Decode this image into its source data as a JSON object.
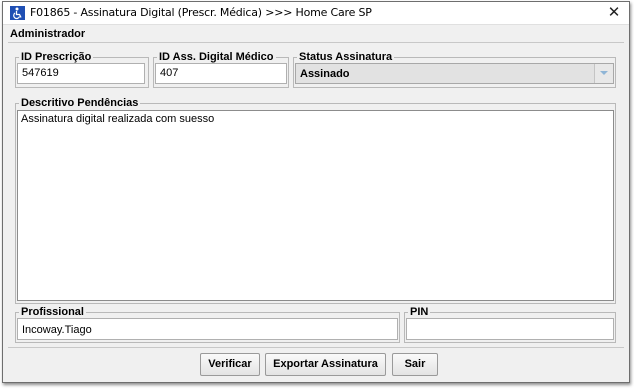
{
  "window": {
    "title": "F01865 - Assinatura Digital (Prescr. Médica) >>> Home Care SP",
    "close_symbol": "✕"
  },
  "menubar": {
    "items": [
      "Administrador"
    ]
  },
  "form": {
    "id_prescricao": {
      "label": "ID Prescrição",
      "value": "547619"
    },
    "id_ass_digital": {
      "label": "ID Ass. Digital Médico",
      "value": "407"
    },
    "status_assinatura": {
      "label": "Status Assinatura",
      "selected": "Assinado"
    },
    "descritivo": {
      "label": "Descritivo Pendências",
      "value": "Assinatura digital realizada com suesso"
    },
    "profissional": {
      "label": "Profissional",
      "value": "Incoway.Tiago"
    },
    "pin": {
      "label": "PIN",
      "value": ""
    }
  },
  "buttons": {
    "verificar": "Verificar",
    "exportar": "Exportar Assinatura",
    "sair": "Sair"
  },
  "icons": {
    "app": "wheelchair-icon",
    "close": "close-icon",
    "dropdown": "chevron-down-icon"
  },
  "colors": {
    "window_bg": "#f0f0f0",
    "field_bg": "#ffffff",
    "combo_bg": "#e2e2e2",
    "arrow": "#8fb5d6"
  }
}
